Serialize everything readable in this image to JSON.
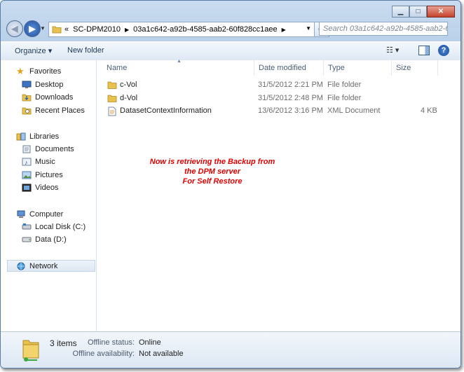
{
  "window": {
    "controls": {
      "minimize": "▁",
      "maximize": "□",
      "close": "✕"
    }
  },
  "address_bar": {
    "chevrons": "«",
    "crumbs": [
      "SC-DPM2010",
      "03a1c642-a92b-4585-aab2-60f828cc1aee"
    ],
    "search_placeholder": "Search 03a1c642-a92b-4585-aab2-60f..."
  },
  "toolbar": {
    "organize_label": "Organize ▾",
    "new_folder_label": "New folder"
  },
  "nav_pane": {
    "favorites": {
      "label": "Favorites",
      "items": [
        "Desktop",
        "Downloads",
        "Recent Places"
      ]
    },
    "libraries": {
      "label": "Libraries",
      "items": [
        "Documents",
        "Music",
        "Pictures",
        "Videos"
      ]
    },
    "computer": {
      "label": "Computer",
      "items": [
        "Local Disk (C:)",
        "Data (D:)"
      ]
    },
    "network": {
      "label": "Network"
    }
  },
  "columns": {
    "name": "Name",
    "date_modified": "Date modified",
    "type": "Type",
    "size": "Size"
  },
  "files": [
    {
      "name": "c-Vol",
      "date": "31/5/2012 2:21 PM",
      "type": "File folder",
      "size": "",
      "icon": "folder-icon"
    },
    {
      "name": "d-Vol",
      "date": "31/5/2012 2:48 PM",
      "type": "File folder",
      "size": "",
      "icon": "folder-icon"
    },
    {
      "name": "DatasetContextInformation",
      "date": "13/6/2012 3:16 PM",
      "type": "XML Document",
      "size": "4 KB",
      "icon": "xml-document-icon"
    }
  ],
  "annotation": {
    "line1": "Now is retrieving the Backup from",
    "line2": "the DPM server",
    "line3": "For Self Restore",
    "color": "#e00000"
  },
  "details_pane": {
    "count": "3 items",
    "offline_status_label": "Offline status:",
    "offline_status_value": "Online",
    "offline_availability_label": "Offline availability:",
    "offline_availability_value": "Not available"
  }
}
